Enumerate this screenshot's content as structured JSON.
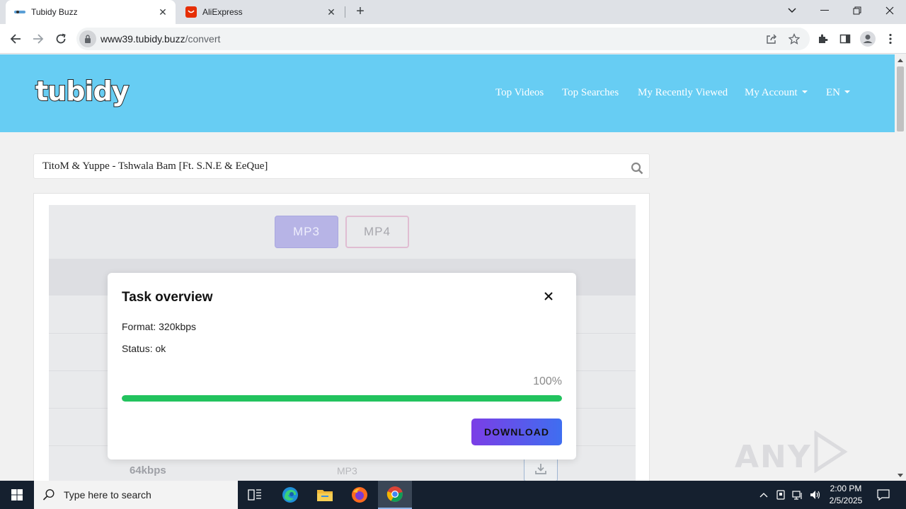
{
  "browser": {
    "tabs": [
      {
        "title": "Tubidy Buzz",
        "active": true
      },
      {
        "title": "AliExpress",
        "active": false
      }
    ],
    "url_host": "www39.tubidy.buzz",
    "url_path": "/convert"
  },
  "site": {
    "logo": "tubidy",
    "nav": {
      "top_videos": "Top Videos",
      "top_searches": "Top Searches",
      "recently_viewed": "My Recently Viewed",
      "my_account": "My Account",
      "language": "EN"
    },
    "search": {
      "value": "TitoM & Yuppe - Tshwala Bam [Ft. S.N.E & EeQue]"
    },
    "format_tabs": {
      "mp3": "MP3",
      "mp4": "MP4"
    },
    "table_row": {
      "quality": "64kbps",
      "format": "MP3"
    }
  },
  "modal": {
    "title": "Task overview",
    "format_line": "Format: 320kbps",
    "status_line": "Status: ok",
    "progress_label": "100%",
    "progress_fraction": 1.0,
    "download_label": "DOWNLOAD"
  },
  "watermark": "ANY RUN",
  "taskbar": {
    "search_placeholder": "Type here to search",
    "time": "2:00 PM",
    "date": "2/5/2025"
  },
  "colors": {
    "header": "#67cdf3",
    "progress": "#22c35e",
    "download_start": "#7b3ee6",
    "download_end": "#3f6ef0"
  }
}
